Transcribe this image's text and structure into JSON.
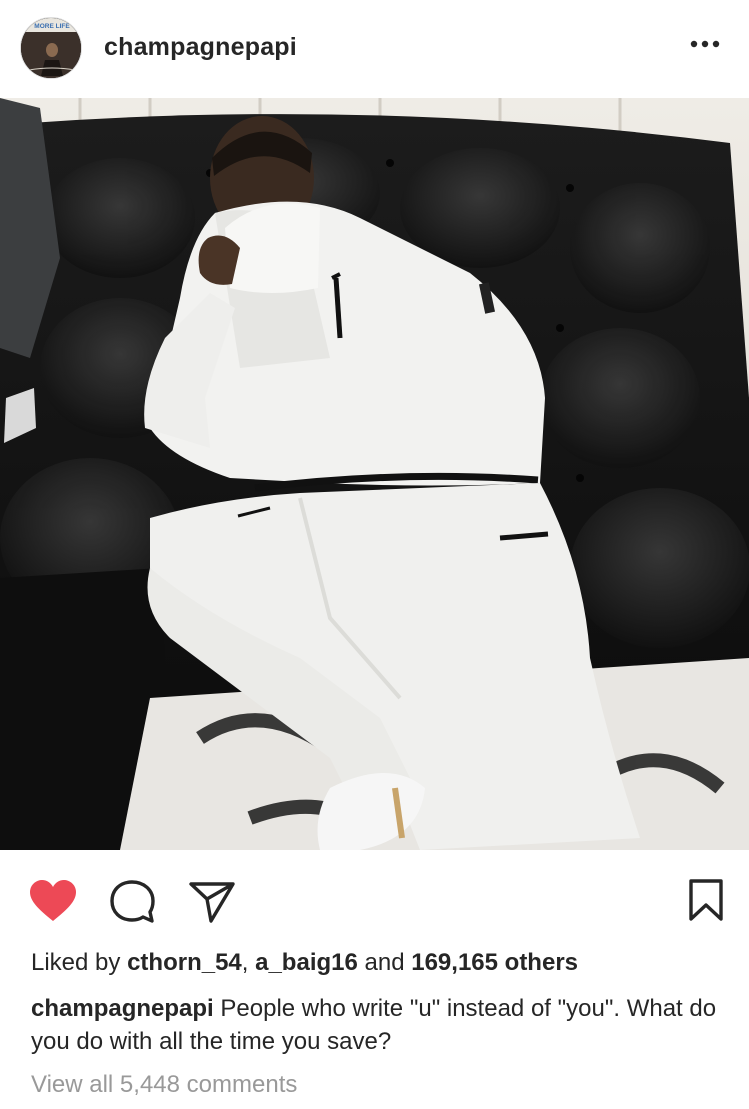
{
  "post": {
    "username": "champagnepapi",
    "avatar_text": "MORE LIFE",
    "menu_icon": "more-horizontal-icon",
    "liked_by_prefix": "Liked by",
    "liked_user_1": "cthorn_54",
    "liked_sep": ",",
    "liked_user_2": "a_baig16",
    "liked_and": "and",
    "liked_others": "169,165 others",
    "caption_user": "champagnepapi",
    "caption_text": "People who write \"u\" instead of \"you\". What do you do with all the time you save?",
    "view_comments": "View all 5,448 comments"
  },
  "actions": {
    "like_icon": "heart-filled-icon",
    "comment_icon": "comment-bubble-icon",
    "share_icon": "send-paper-plane-icon",
    "save_icon": "bookmark-icon",
    "like_color": "#ed4956"
  }
}
